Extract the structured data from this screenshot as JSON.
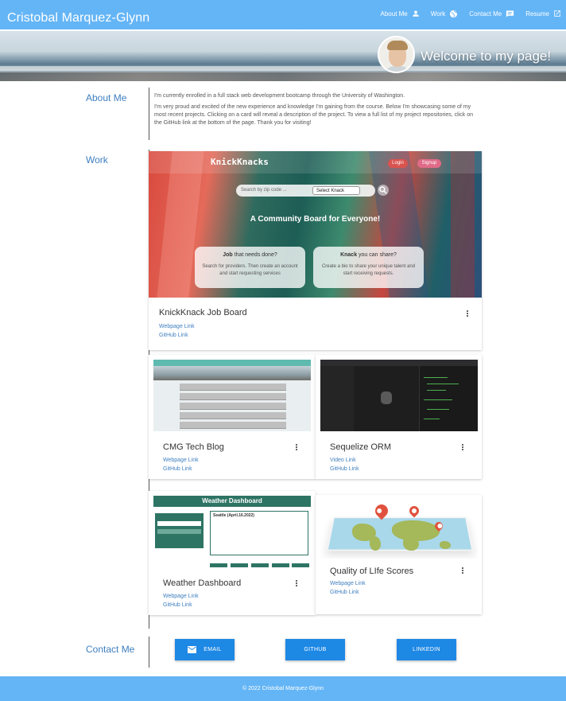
{
  "header": {
    "brand": "Cristobal Marquez-Glynn",
    "nav": [
      {
        "label": "About Me",
        "icon": "person-icon"
      },
      {
        "label": "Work",
        "icon": "globe-icon"
      },
      {
        "label": "Contact Me",
        "icon": "chat-icon"
      },
      {
        "label": "Resume",
        "icon": "open-in-new-icon"
      }
    ]
  },
  "banner": {
    "welcome": "Welcome to my page!"
  },
  "about": {
    "label": "About Me",
    "p1": "I'm currently enrolled in a full stack web development bootcamp through the University of Washington.",
    "p2": "I'm very proud and excited of the new experience and knowledge I'm gaining from the course. Below I'm showcasing some of my most recent projects. Clicking on a card will reveal a description of the project. To view a full list of my project repositories, click on the GitHub link at the bottom of the page. Thank you for visiting!"
  },
  "work": {
    "label": "Work",
    "knickknacks_shot": {
      "logo": "KnickKnacks",
      "login": "Login",
      "signup": "Signup",
      "search_placeholder": "Search by zip code ...",
      "select": "Select Knack",
      "tagline": "A Community Board for Everyone!",
      "box1_title_bold": "Job",
      "box1_title_rest": " that needs done?",
      "box1_text": "Search for providers. Then create an account and start requesting services",
      "box2_title_bold": "Knack",
      "box2_title_rest": " you can share?",
      "box2_text": "Create a bio to share your unique talent and start receiving requests."
    },
    "weather_shot": {
      "title": "Weather Dashboard",
      "city": "Seattle (April.16.2022)"
    },
    "cards": [
      {
        "title": "KnickKnack Job Board",
        "link1": "Webpage Link",
        "link2": "GitHub Link"
      },
      {
        "title": "CMG Tech Blog",
        "link1": "Webpage Link",
        "link2": "GitHub Link"
      },
      {
        "title": "Sequelize ORM",
        "link1": "Video Link",
        "link2": "GitHub Link"
      },
      {
        "title": "Weather Dashboard",
        "link1": "Webpage Link",
        "link2": "GitHub Link"
      },
      {
        "title": "Quality of LIfe Scores",
        "link1": "Webpage Link",
        "link2": "GitHub Link"
      }
    ]
  },
  "contact": {
    "label": "Contact Me",
    "buttons": [
      {
        "label": "EMAIL",
        "icon": "mail-icon"
      },
      {
        "label": "GITHUB"
      },
      {
        "label": "LINKEDIN"
      }
    ]
  },
  "footer": {
    "text": "© 2022 Cristobal Marquez-Glynn"
  },
  "colors": {
    "header": "#64b5f6",
    "accent": "#1e88e5",
    "link": "#3f7fbf"
  }
}
